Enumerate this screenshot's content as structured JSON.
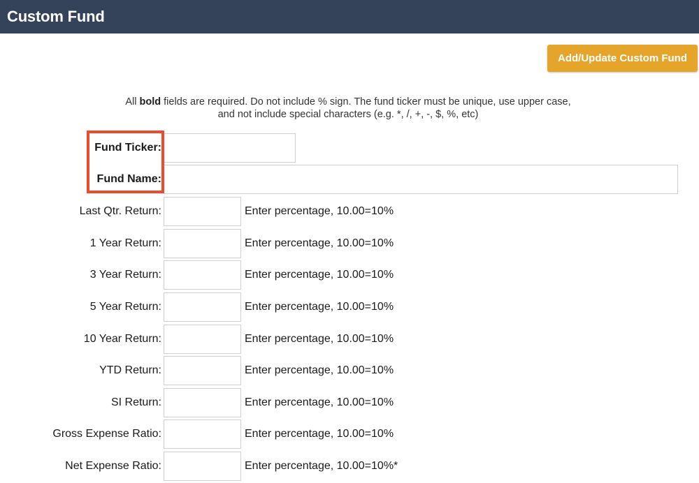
{
  "header": {
    "title": "Custom Fund"
  },
  "toolbar": {
    "add_update_label": "Add/Update Custom Fund"
  },
  "instructions": {
    "prefix": "All ",
    "bold_word": "bold",
    "line1_rest": " fields are required. Do not include % sign. The fund ticker must be unique, use upper case,",
    "line2": "and not include special characters (e.g. *, /, +, -, $, %, etc)"
  },
  "fields": {
    "fund_ticker": {
      "label": "Fund Ticker:",
      "value": ""
    },
    "fund_name": {
      "label": "Fund Name:",
      "value": ""
    },
    "last_qtr_return": {
      "label": "Last Qtr. Return:",
      "value": "",
      "hint": "Enter percentage, 10.00=10%"
    },
    "one_year_return": {
      "label": "1 Year Return:",
      "value": "",
      "hint": "Enter percentage, 10.00=10%"
    },
    "three_year_return": {
      "label": "3 Year Return:",
      "value": "",
      "hint": "Enter percentage, 10.00=10%"
    },
    "five_year_return": {
      "label": "5 Year Return:",
      "value": "",
      "hint": "Enter percentage, 10.00=10%"
    },
    "ten_year_return": {
      "label": "10 Year Return:",
      "value": "",
      "hint": "Enter percentage, 10.00=10%"
    },
    "ytd_return": {
      "label": "YTD Return:",
      "value": "",
      "hint": "Enter percentage, 10.00=10%"
    },
    "si_return": {
      "label": "SI Return:",
      "value": "",
      "hint": "Enter percentage, 10.00=10%"
    },
    "gross_expense_ratio": {
      "label": "Gross Expense Ratio:",
      "value": "",
      "hint": "Enter percentage, 10.00=10%"
    },
    "net_expense_ratio": {
      "label": "Net Expense Ratio:",
      "value": "",
      "hint": "Enter percentage, 10.00=10%*"
    }
  },
  "colors": {
    "header_bg": "#34425a",
    "button_bg": "#e4a52a",
    "highlight": "#ef4a2c"
  }
}
